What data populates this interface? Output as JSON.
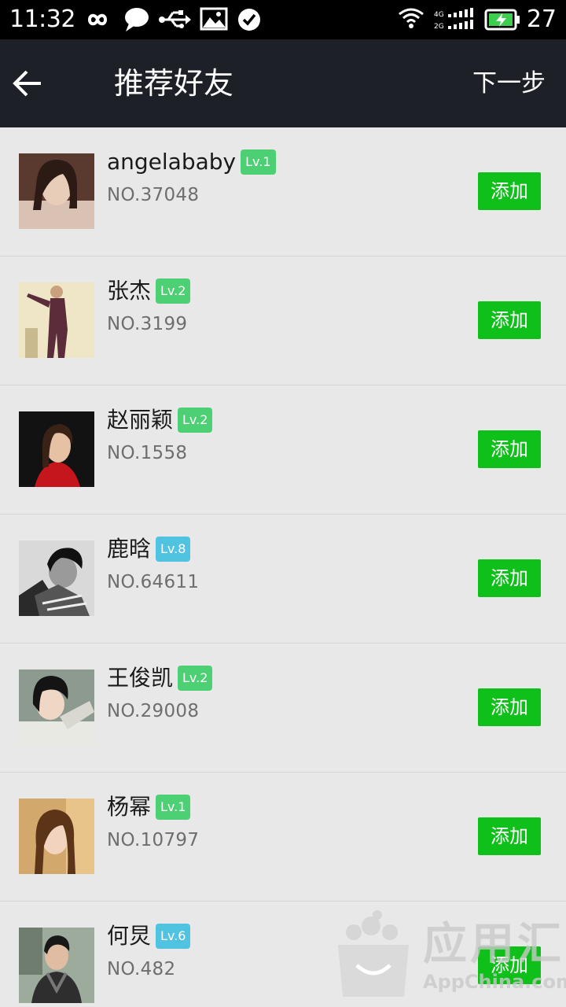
{
  "status_bar": {
    "time": "11:32",
    "battery_level": "27",
    "network_labels": [
      "4G",
      "2G"
    ],
    "left_icons": [
      "infinity-icon",
      "chat-bubble-icon",
      "usb-icon",
      "image-icon",
      "check-circle-icon"
    ],
    "right_icons": [
      "wifi-icon",
      "signal-icon",
      "battery-charging-icon"
    ]
  },
  "header": {
    "title": "推荐好友",
    "next_label": "下一步",
    "back_icon": "arrow-left-icon"
  },
  "friends": [
    {
      "name": "angelababy",
      "level": "Lv.1",
      "number": "NO.37048",
      "add_label": "添加",
      "badge_color": "#4cd073"
    },
    {
      "name": "张杰",
      "level": "Lv.2",
      "number": "NO.3199",
      "add_label": "添加",
      "badge_color": "#4cd073"
    },
    {
      "name": "赵丽颖",
      "level": "Lv.2",
      "number": "NO.1558",
      "add_label": "添加",
      "badge_color": "#4cd073"
    },
    {
      "name": "鹿晗",
      "level": "Lv.8",
      "number": "NO.64611",
      "add_label": "添加",
      "badge_color": "#50c3e0"
    },
    {
      "name": "王俊凯",
      "level": "Lv.2",
      "number": "NO.29008",
      "add_label": "添加",
      "badge_color": "#4cd073"
    },
    {
      "name": "杨幂",
      "level": "Lv.1",
      "number": "NO.10797",
      "add_label": "添加",
      "badge_color": "#4cd073"
    },
    {
      "name": "何炅",
      "level": "Lv.6",
      "number": "NO.482",
      "add_label": "添加",
      "badge_color": "#50c3e0"
    }
  ],
  "watermark": {
    "title": "应用汇",
    "subtitle": "AppChina.com"
  },
  "colors": {
    "add_button": "#0fbf1a",
    "header_bg": "#1d2127",
    "list_bg": "#e8e8e8"
  }
}
